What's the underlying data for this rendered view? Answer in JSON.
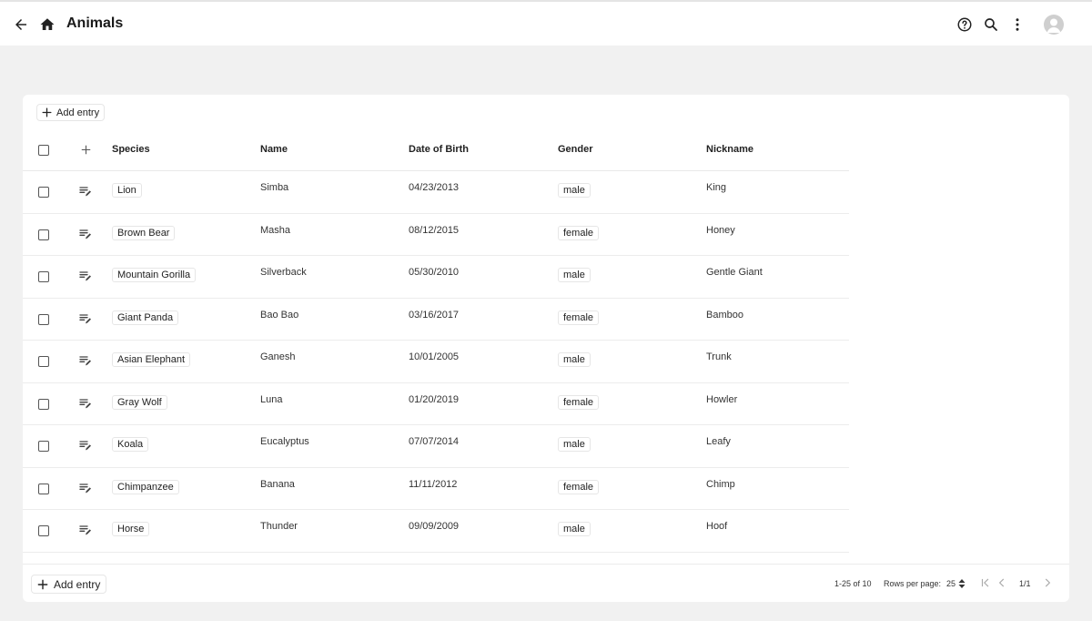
{
  "header": {
    "title": "Animals",
    "icons": [
      "arrow-left-icon",
      "home-icon",
      "help-circle-icon",
      "search-icon",
      "more-vertical-icon",
      "user-avatar-icon"
    ]
  },
  "toolbar": {
    "add_entry_label": "Add entry"
  },
  "table": {
    "columns": [
      "Species",
      "Name",
      "Date of Birth",
      "Gender",
      "Nickname"
    ],
    "rows": [
      {
        "species": "Lion",
        "name": "Simba",
        "dob": "04/23/2013",
        "gender": "male",
        "nickname": "King"
      },
      {
        "species": "Brown Bear",
        "name": "Masha",
        "dob": "08/12/2015",
        "gender": "female",
        "nickname": "Honey"
      },
      {
        "species": "Mountain Gorilla",
        "name": "Silverback",
        "dob": "05/30/2010",
        "gender": "male",
        "nickname": "Gentle Giant"
      },
      {
        "species": "Giant Panda",
        "name": "Bao Bao",
        "dob": "03/16/2017",
        "gender": "female",
        "nickname": "Bamboo"
      },
      {
        "species": "Asian Elephant",
        "name": "Ganesh",
        "dob": "10/01/2005",
        "gender": "male",
        "nickname": "Trunk"
      },
      {
        "species": "Gray Wolf",
        "name": "Luna",
        "dob": "01/20/2019",
        "gender": "female",
        "nickname": "Howler"
      },
      {
        "species": "Koala",
        "name": "Eucalyptus",
        "dob": "07/07/2014",
        "gender": "male",
        "nickname": "Leafy"
      },
      {
        "species": "Chimpanzee",
        "name": "Banana",
        "dob": "11/11/2012",
        "gender": "female",
        "nickname": "Chimp"
      },
      {
        "species": "Horse",
        "name": "Thunder",
        "dob": "09/09/2009",
        "gender": "male",
        "nickname": "Hoof"
      }
    ]
  },
  "footer": {
    "add_entry_label": "Add entry",
    "range_text": "1-25 of 10",
    "rows_per_page_label": "Rows per page:",
    "rows_per_page_value": "25",
    "page_indicator": "1/1"
  },
  "colors": {
    "background": "#f1f1f1",
    "card": "#ffffff",
    "text": "#1f1f1f",
    "border": "#e6e6e6"
  }
}
